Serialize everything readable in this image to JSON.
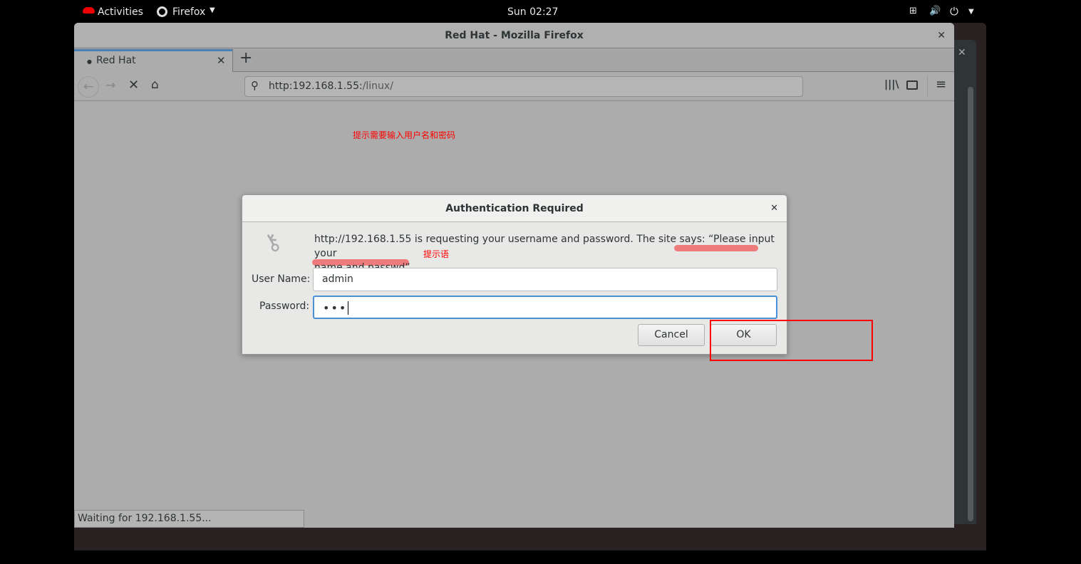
{
  "topbar": {
    "activities": "Activities",
    "app": "Firefox",
    "clock": "Sun 02:27"
  },
  "window": {
    "title": "Red Hat - Mozilla Firefox"
  },
  "tab": {
    "label": "Red Hat"
  },
  "url": {
    "host": "http:192.168.1.55:",
    "path": "/linux/"
  },
  "annotation": {
    "top": "提示需要输入用户名和密码",
    "prompt": "提示语"
  },
  "dialog": {
    "title": "Authentication Required",
    "message_line1": "http://192.168.1.55 is requesting your username and password. The site says: “Please input your",
    "message_line2": "name and passwd”",
    "username_label": "User Name:",
    "username": "admin",
    "password_label": "Password:",
    "password": "•••",
    "cancel": "Cancel",
    "ok": "OK"
  },
  "status": "Waiting for 192.168.1.55...",
  "colors": {
    "annotation": "#ff0000",
    "highlight": "#f07070",
    "tab_accent": "#4a7fb5"
  }
}
